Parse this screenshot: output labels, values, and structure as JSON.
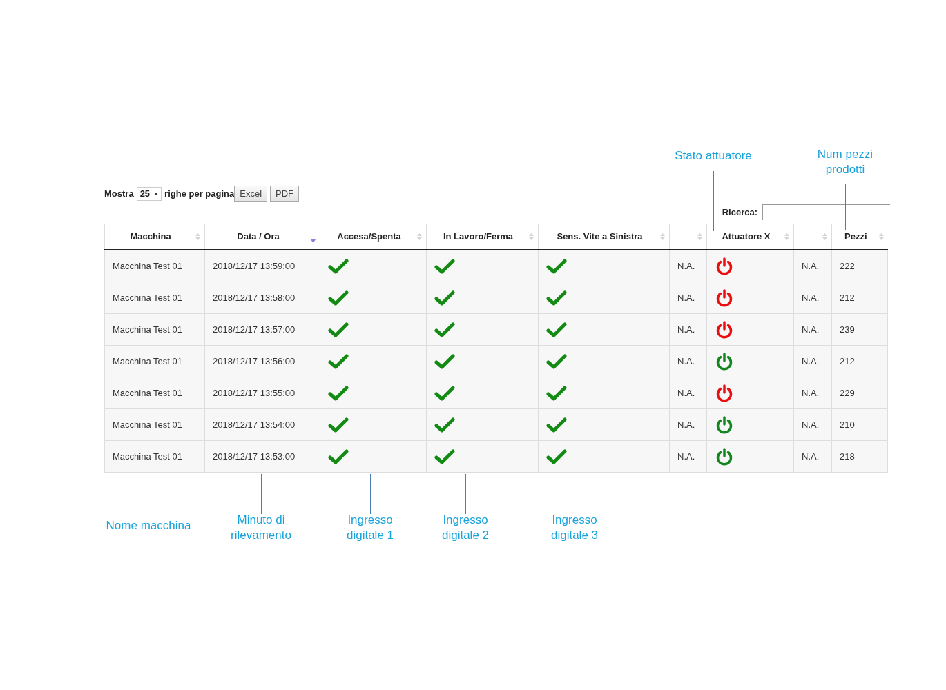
{
  "toolbar": {
    "show_label": "Mostra",
    "page_size": "25",
    "rows_label": "righe per pagina",
    "buttons": [
      "Excel",
      "PDF"
    ]
  },
  "search": {
    "label": "Ricerca:"
  },
  "table": {
    "columns": [
      {
        "label": "Macchina",
        "sorted": false
      },
      {
        "label": "Data / Ora",
        "sorted": true
      },
      {
        "label": "Accesa/Spenta",
        "sorted": false
      },
      {
        "label": "In Lavoro/Ferma",
        "sorted": false
      },
      {
        "label": "Sens. Vite a Sinistra",
        "sorted": false
      },
      {
        "sorted": false
      },
      {
        "label": "Attuatore X",
        "sorted": false
      },
      {
        "sorted": false
      },
      {
        "label": "Pezzi",
        "sorted": false
      }
    ],
    "rows": [
      {
        "machine": "Macchina Test 01",
        "time": "2018/12/17 13:59:00",
        "inputs": [
          true,
          true,
          true
        ],
        "na_1": "N.A.",
        "actuator_on": false,
        "na_2": "N.A.",
        "pieces": "222"
      },
      {
        "machine": "Macchina Test 01",
        "time": "2018/12/17 13:58:00",
        "inputs": [
          true,
          true,
          true
        ],
        "na_1": "N.A.",
        "actuator_on": false,
        "na_2": "N.A.",
        "pieces": "212"
      },
      {
        "machine": "Macchina Test 01",
        "time": "2018/12/17 13:57:00",
        "inputs": [
          true,
          true,
          true
        ],
        "na_1": "N.A.",
        "actuator_on": false,
        "na_2": "N.A.",
        "pieces": "239"
      },
      {
        "machine": "Macchina Test 01",
        "time": "2018/12/17 13:56:00",
        "inputs": [
          true,
          true,
          true
        ],
        "na_1": "N.A.",
        "actuator_on": true,
        "na_2": "N.A.",
        "pieces": "212"
      },
      {
        "machine": "Macchina Test 01",
        "time": "2018/12/17 13:55:00",
        "inputs": [
          true,
          true,
          true
        ],
        "na_1": "N.A.",
        "actuator_on": false,
        "na_2": "N.A.",
        "pieces": "229"
      },
      {
        "machine": "Macchina Test 01",
        "time": "2018/12/17 13:54:00",
        "inputs": [
          true,
          true,
          true
        ],
        "na_1": "N.A.",
        "actuator_on": true,
        "na_2": "N.A.",
        "pieces": "210"
      },
      {
        "machine": "Macchina Test 01",
        "time": "2018/12/17 13:53:00",
        "inputs": [
          true,
          true,
          true
        ],
        "na_1": "N.A.",
        "actuator_on": true,
        "na_2": "N.A.",
        "pieces": "218"
      }
    ]
  },
  "top_annotations": [
    "Stato attuatore",
    "Num pezzi\nprodotti"
  ],
  "bottom_annotations": [
    "Nome macchina",
    "Minuto di\nrilevamento",
    "Ingresso\ndigitale 1",
    "Ingresso\ndigitale 2",
    "Ingresso\ndigitale 3"
  ]
}
